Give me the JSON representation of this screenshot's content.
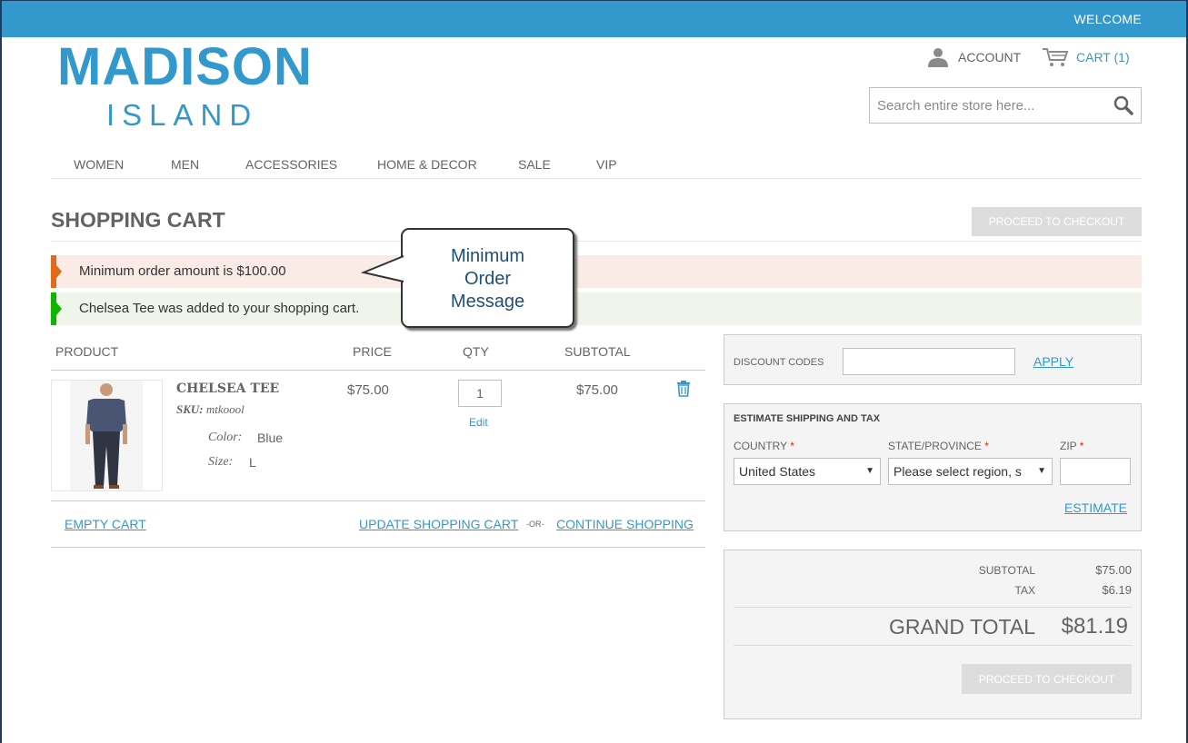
{
  "header": {
    "welcome": "WELCOME",
    "logo_main": "MADISON",
    "logo_sub": "ISLAND",
    "account": "ACCOUNT",
    "cart": "CART (1)",
    "search_placeholder": "Search entire store here..."
  },
  "nav": [
    "WOMEN",
    "MEN",
    "ACCESSORIES",
    "HOME & DECOR",
    "SALE",
    "VIP"
  ],
  "page": {
    "title": "SHOPPING CART",
    "checkout_label": "PROCEED TO CHECKOUT"
  },
  "messages": {
    "error": "Minimum order amount is $100.00",
    "success": "Chelsea Tee was added to your shopping cart."
  },
  "callout": {
    "line1": "Minimum",
    "line2": "Order",
    "line3": "Message"
  },
  "cart_table": {
    "headers": [
      "PRODUCT",
      "PRICE",
      "QTY",
      "SUBTOTAL"
    ],
    "item": {
      "name": "CHELSEA TEE",
      "sku_label": "SKU:",
      "sku": "mtkoool",
      "options": [
        {
          "label": "Color:",
          "value": "Blue"
        },
        {
          "label": "Size:",
          "value": "L"
        }
      ],
      "price": "$75.00",
      "qty": "1",
      "edit": "Edit",
      "subtotal": "$75.00"
    },
    "empty_cart": "EMPTY CART",
    "update_cart": "UPDATE SHOPPING CART",
    "or": "-OR-",
    "continue_shopping": "CONTINUE SHOPPING"
  },
  "discount": {
    "label": "DISCOUNT CODES",
    "apply": "APPLY"
  },
  "shipping": {
    "title": "ESTIMATE SHIPPING AND TAX",
    "country_label": "COUNTRY",
    "country_value": "United States",
    "state_label": "STATE/PROVINCE",
    "state_value": "Please select region, s",
    "zip_label": "ZIP",
    "required_mark": "*",
    "estimate": "ESTIMATE"
  },
  "totals": {
    "subtotal_label": "SUBTOTAL",
    "subtotal": "$75.00",
    "tax_label": "TAX",
    "tax": "$6.19",
    "grand_total_label": "GRAND TOTAL",
    "grand_total": "$81.19",
    "checkout_label": "PROCEED TO CHECKOUT"
  },
  "colors": {
    "brand": "#3399cc",
    "error_accent": "#df6a1a",
    "success_accent": "#11b400"
  }
}
